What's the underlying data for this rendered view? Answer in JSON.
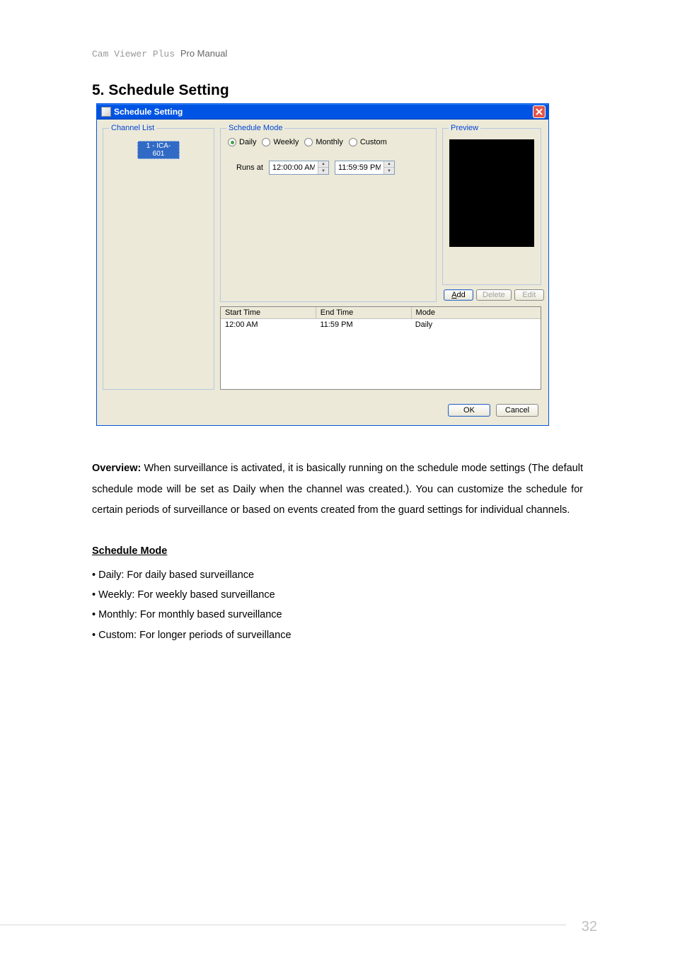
{
  "header": {
    "prefix": "Cam Viewer Plus ",
    "suffix": "Pro Manual"
  },
  "section_heading": "5.  Schedule Setting",
  "dialog": {
    "title": "Schedule Setting",
    "channel_list": {
      "legend": "Channel List",
      "item": "1 - ICA-601"
    },
    "schedule_mode": {
      "legend": "Schedule Mode",
      "options": {
        "daily": "Daily",
        "weekly": "Weekly",
        "monthly": "Monthly",
        "custom": "Custom"
      },
      "runs_at_label": "Runs at",
      "time_from": "12:00:00 AM",
      "time_to": "11:59:59 PM"
    },
    "preview": {
      "legend": "Preview"
    },
    "buttons": {
      "add": "Add",
      "delete": "Delete",
      "edit": "Edit",
      "ok": "OK",
      "cancel": "Cancel"
    },
    "table": {
      "headers": {
        "start": "Start Time",
        "end": "End Time",
        "mode": "Mode"
      },
      "row": {
        "start": "12:00 AM",
        "end": "11:59 PM",
        "mode": "Daily"
      }
    }
  },
  "overview": {
    "label": "Overview:",
    "text": " When surveillance is activated, it is basically running on the schedule mode settings (The default schedule mode will be set as Daily when the channel was created.). You can customize the schedule for certain periods of surveillance or based on events created from the guard settings for individual channels."
  },
  "schedule_mode_section": {
    "heading": "Schedule Mode",
    "bullets": {
      "b1": "• Daily: For daily based surveillance",
      "b2": "• Weekly: For weekly based surveillance",
      "b3": "• Monthly: For monthly based surveillance",
      "b4": "• Custom: For longer periods of surveillance"
    }
  },
  "page_number": "32"
}
